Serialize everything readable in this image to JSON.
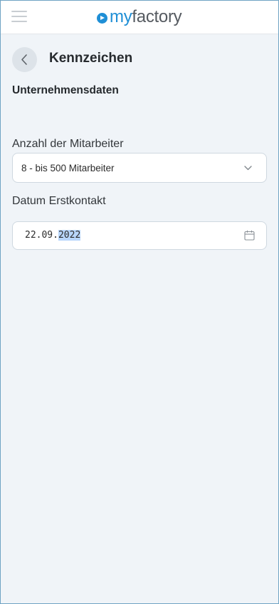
{
  "header": {
    "menu_icon": "hamburger-menu-icon",
    "logo": {
      "prefix": "my",
      "suffix": "factory",
      "brand_color": "#1f8fd6"
    }
  },
  "page": {
    "title": "Kennzeichen",
    "back_icon": "chevron-left-icon"
  },
  "section": {
    "title": "Unternehmensdaten"
  },
  "fields": {
    "employees": {
      "label": "Anzahl der Mitarbeiter",
      "value": "8 - bis 500 Mitarbeiter",
      "icon": "chevron-down-icon"
    },
    "first_contact": {
      "label": "Datum Erstkontakt",
      "value_day_month": "22.09.",
      "value_year_selected": "2022",
      "icon": "calendar-icon"
    }
  },
  "colors": {
    "background": "#f0f4f8",
    "accent": "#1f8fd6",
    "selection": "#b8d6fb"
  }
}
